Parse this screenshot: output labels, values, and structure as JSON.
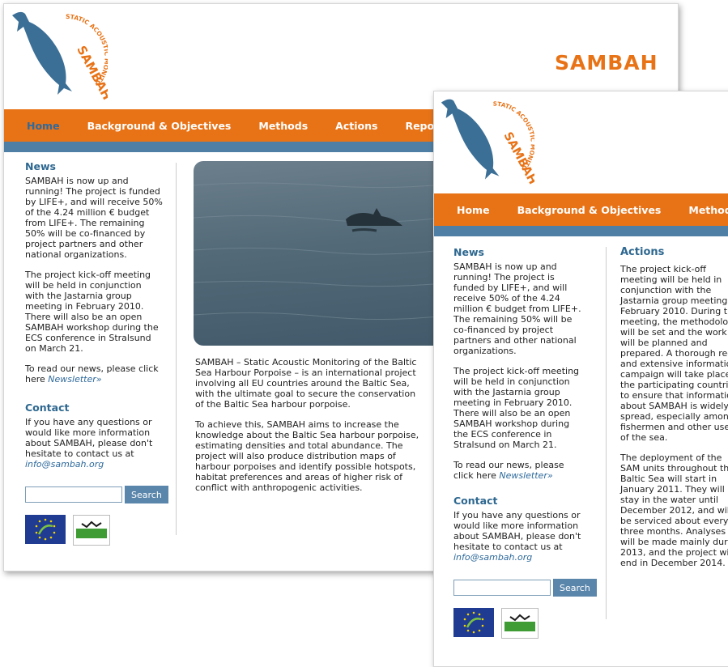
{
  "site": {
    "name": "SAMBAH",
    "logo_text": "STATIC ACOUSTIC MONITORING OF THE BALTIC SEA HARBOUR PORPOISE"
  },
  "colors": {
    "accent": "#e87317",
    "nav_blue": "#4f7fa5",
    "link": "#2f6a9c"
  },
  "pageA": {
    "nav": [
      "Home",
      "Background & Objectives",
      "Methods",
      "Actions",
      "Report"
    ],
    "sidebar": {
      "news_title": "News",
      "news_p1": "SAMBAH is now up and running! The project is funded by LIFE+, and will receive 50% of the 4.24 million € budget from LIFE+. The remaining 50% will be co-financed by project partners and other national organizations.",
      "news_p2": "The project kick-off meeting will be held in conjunction with the Jastarnia group meeting in February 2010. There will also be an open SAMBAH workshop during the ECS conference in Stralsund on March 21.",
      "news_p3": "To read our news, please click here",
      "newsletter_link": "Newsletter»",
      "contact_title": "Contact",
      "contact_text": "If you have any questions or would like more information about SAMBAH, please don't hesitate to contact us at",
      "contact_email": "info@sambah.org",
      "search_button": "Search"
    },
    "main_p1": "SAMBAH – Static Acoustic Monitoring of the Baltic Sea Harbour Porpoise – is an international project involving all EU countries around the Baltic Sea, with the ultimate goal to secure the conservation of the Baltic Sea harbour porpoise.",
    "main_p2": "To achieve this, SAMBAH aims to increase the knowledge about the Baltic Sea harbour porpoise, estimating densities and total abundance. The project will also produce distribution maps of harbour porpoises and identify possible hotspots, habitat preferences and areas of higher risk of conflict with anthropogenic activities."
  },
  "pageB": {
    "nav": [
      "Home",
      "Background & Objectives",
      "Methods"
    ],
    "sidebar": {
      "news_title": "News",
      "news_p1": "SAMBAH is now up and running! The project is funded by LIFE+, and will receive 50% of the 4.24 million € budget from LIFE+. The remaining 50% will be co-financed by project partners and other national organizations.",
      "news_p2": "The project kick-off meeting will be held in conjunction with the Jastarnia group meeting in February 2010. There will also be an open SAMBAH workshop during the ECS conference in Stralsund on March 21.",
      "news_p3": "To read our news, please click here",
      "newsletter_link": "Newsletter»",
      "contact_title": "Contact",
      "contact_text": "If you have any questions or would like more information about SAMBAH, please don't hesitate to contact us at",
      "contact_email": "info@sambah.org",
      "search_button": "Search"
    },
    "actions_title": "Actions",
    "actions_p1": "The project kick-off meeting will be held in conjunction with the Jastarnia group meeting in February 2010. During the meeting, the methodology will be set and the work will be planned and prepared. A thorough red and extensive information campaign will take place in the participating countries to ensure that information about SAMBAH is widely spread, especially among fishermen and other users of the sea.",
    "actions_p2": "The deployment of the SAM units throughout the Baltic Sea will start in January 2011. They will stay in the water until December 2012, and will be serviced about every three months. Analyses will be made mainly during 2013, and the project will end in December 2014."
  }
}
